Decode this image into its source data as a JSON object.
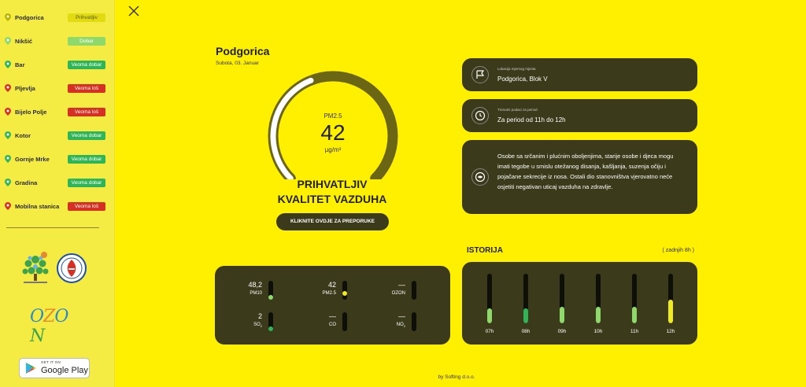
{
  "sidebar": {
    "stations": [
      {
        "name": "Podgorica",
        "status": "Prihvatljiv",
        "badge_color": "#E3DB12",
        "badge_text_color": "#5a5a10",
        "pin_color": "#B9B400"
      },
      {
        "name": "Nikšić",
        "status": "Dobar",
        "badge_color": "#8FD86A",
        "badge_text_color": "#ffffff",
        "pin_color": "#8FD86A"
      },
      {
        "name": "Bar",
        "status": "Veoma dobar",
        "badge_color": "#2FB558",
        "badge_text_color": "#ffffff",
        "pin_color": "#2FB558"
      },
      {
        "name": "Pljevlja",
        "status": "Veoma loš",
        "badge_color": "#D62F23",
        "badge_text_color": "#ffffff",
        "pin_color": "#D62F23"
      },
      {
        "name": "Bijelo Polje",
        "status": "Veoma loš",
        "badge_color": "#D62F23",
        "badge_text_color": "#ffffff",
        "pin_color": "#D62F23"
      },
      {
        "name": "Kotor",
        "status": "Veoma dobar",
        "badge_color": "#2FB558",
        "badge_text_color": "#ffffff",
        "pin_color": "#2FB558"
      },
      {
        "name": "Gornje Mrke",
        "status": "Veoma dobar",
        "badge_color": "#2FB558",
        "badge_text_color": "#ffffff",
        "pin_color": "#2FB558"
      },
      {
        "name": "Gradina",
        "status": "Veoma dobar",
        "badge_color": "#2FB558",
        "badge_text_color": "#ffffff",
        "pin_color": "#2FB558"
      },
      {
        "name": "Mobilna stanica",
        "status": "Veoma loš",
        "badge_color": "#D62F23",
        "badge_text_color": "#ffffff",
        "pin_color": "#D62F23"
      }
    ],
    "logo_ozon_text": "OZON",
    "google_play": {
      "small": "GET IT ON",
      "big": "Google Play"
    }
  },
  "main": {
    "city": "Podgorica",
    "date": "Subota, 03. Januar",
    "gauge": {
      "label": "PM2.5",
      "value": "42",
      "unit": "µg/m³",
      "fill_fraction": 0.42
    },
    "quality_line1": "PRIHVATLJIV",
    "quality_line2": "KVALITET VAZDUHA",
    "reco_button": "KLIKNITE OVDJE ZA PREPORUKE",
    "location_card": {
      "small": "Lokacija mjernog mjesta",
      "main": "Podgorica, Blok V"
    },
    "period_card": {
      "small": "Trenutni podaci za period",
      "main": "Za period od 11h do 12h"
    },
    "description": "Osobe sa srčanim i plućnim oboljenjima, starije osobe i djeca mogu imati tegobe u smislu otežanog disanja, kašljanja, suzenja očiju i pojačane sekrecije iz nosa. Ostali dio stanovništva vjerovatno neće osjetiti negativan uticaj vazduha na zdravlje."
  },
  "pollutants": [
    {
      "value": "48,2",
      "name": "PM10",
      "sub": "",
      "dot_color": "#8FD86A",
      "level": 0.0
    },
    {
      "value": "42",
      "name": "PM2.5",
      "sub": "",
      "dot_color": "#F0EB1E",
      "level": 0.25
    },
    {
      "value": "—",
      "name": "OZON",
      "sub": "",
      "dot_color": "",
      "level": 0
    },
    {
      "value": "2",
      "name": "SO",
      "sub": "2",
      "dot_color": "#2FB558",
      "level": 0.0
    },
    {
      "value": "—",
      "name": "CO",
      "sub": "",
      "dot_color": "",
      "level": 0
    },
    {
      "value": "—",
      "name": "NO",
      "sub": "2",
      "dot_color": "",
      "level": 0
    }
  ],
  "history": {
    "title": "ISTORIJA",
    "subtitle": "( zadnjih 8h )",
    "bars": [
      {
        "label": "07h",
        "level": 0.3,
        "color": "#8FD86A"
      },
      {
        "label": "08h",
        "level": 0.3,
        "color": "#2FB558"
      },
      {
        "label": "09h",
        "level": 0.33,
        "color": "#8FD86A"
      },
      {
        "label": "10h",
        "level": 0.33,
        "color": "#8FD86A"
      },
      {
        "label": "11h",
        "level": 0.33,
        "color": "#8FD86A"
      },
      {
        "label": "12h",
        "level": 0.48,
        "color": "#F0EB1E"
      }
    ]
  },
  "footer": "by Softing d.o.o."
}
